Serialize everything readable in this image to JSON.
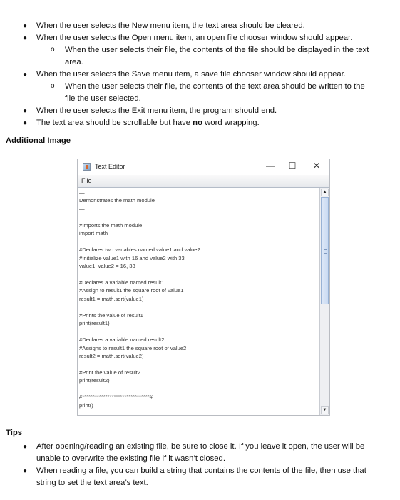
{
  "requirements": [
    {
      "text": "When the user selects the New menu item, the text area should be cleared."
    },
    {
      "text": "When the user selects the Open menu item, an open file chooser window should appear.",
      "sub": [
        "When the user selects their file, the contents of the file should be displayed in the text",
        "area."
      ]
    },
    {
      "text": "When the user selects the Save menu item, a save file chooser window should appear.",
      "sub": [
        "When the user selects their file, the contents of the text area should be written to the",
        "file the user selected."
      ]
    },
    {
      "text": "When the user selects the Exit menu item, the program should end."
    },
    {
      "text_before": "The text area should be scrollable but have ",
      "text_bold": "no",
      "text_after": " word wrapping."
    }
  ],
  "additional_image_heading": "Additional Image",
  "window": {
    "title": "Text Editor",
    "menu_file_mnemonic": "F",
    "menu_file_rest": "ile",
    "minimize": "—",
    "maximize": "☐",
    "close": "✕",
    "scroll_up": "▲",
    "scroll_down": "▼",
    "scroll_thumb_fraction": 0.47,
    "lines": [
      "—",
      "Demonstrates the math module",
      "—",
      "",
      "#Imports the math module",
      "import math",
      "",
      "#Declares two variables named value1 and value2.",
      "#Initialize value1 with 16 and value2 with 33",
      "value1, value2 = 16, 33",
      "",
      "#Declares a variable named result1",
      "#Assign to result1 the square root of value1",
      "result1 = math.sqrt(value1)",
      "",
      "#Prints the value of result1",
      "print(result1)",
      "",
      "#Declares a variable named result2",
      "#Assigns to result1 the square root of value2",
      "result2 = math.sqrt(value2)",
      "",
      "#Print the value of result2",
      "print(result2)",
      "",
      "#********************************#",
      "print()"
    ]
  },
  "tips_heading": "Tips",
  "tips": [
    [
      "After opening/reading an existing file, be sure to close it. If you leave it open, the user will be",
      "unable to overwrite the existing file if it wasn’t closed."
    ],
    [
      "When reading a file, you can build a string that contains the contents of the file, then use that",
      "string to set the text area’s text."
    ]
  ]
}
